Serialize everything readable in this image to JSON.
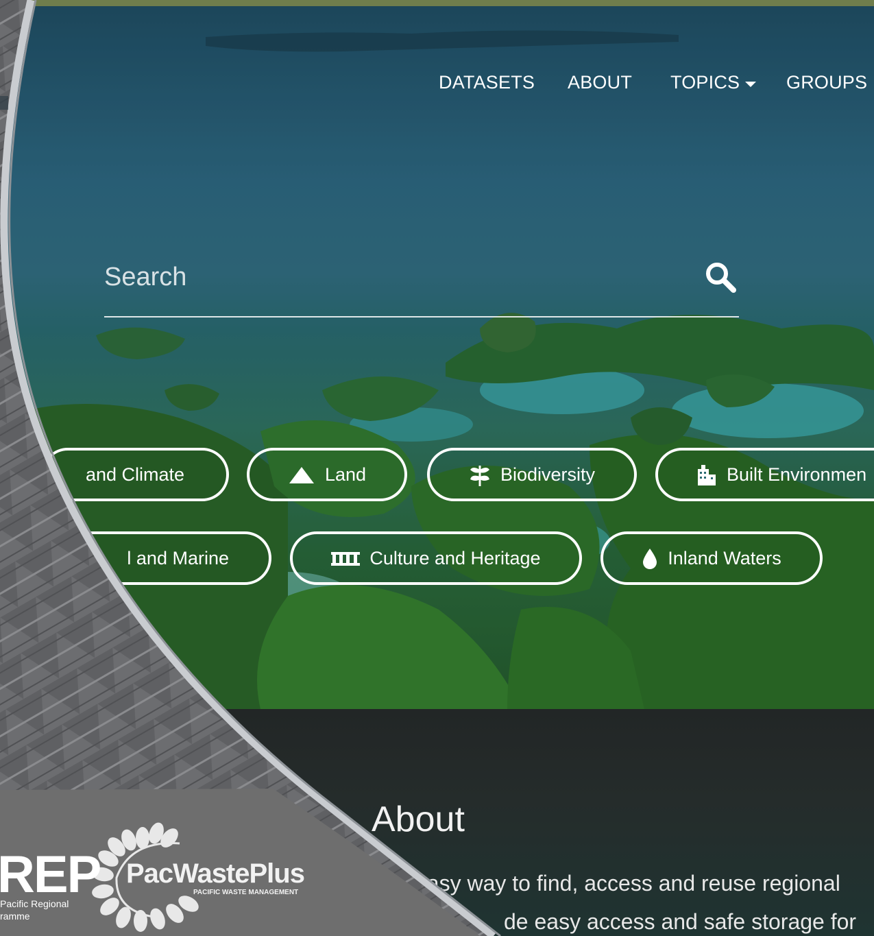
{
  "nav": {
    "items": [
      {
        "label": "DATASETS"
      },
      {
        "label": "ABOUT"
      },
      {
        "label": "TOPICS"
      },
      {
        "label": "GROUPS"
      }
    ]
  },
  "search": {
    "placeholder": "Search",
    "icon": "search-icon"
  },
  "topics": [
    {
      "label": "and Climate",
      "icon": ""
    },
    {
      "label": "Land",
      "icon": "mountain-icon"
    },
    {
      "label": "Biodiversity",
      "icon": "leaf-icon"
    },
    {
      "label": "Built Environmen",
      "icon": "building-icon"
    },
    {
      "label": "l and Marine",
      "icon": ""
    },
    {
      "label": "Culture and Heritage",
      "icon": "monument-icon"
    },
    {
      "label": "Inland Waters",
      "icon": "water-drop-icon"
    }
  ],
  "about": {
    "title": "About",
    "line1": "easy way to find, access and reuse regional",
    "line2": "de easy access and safe storage for"
  },
  "partners": {
    "srep_logo": "REP",
    "srep_sub1": "Pacific Regional",
    "srep_sub2": "ramme",
    "pacwaste_logo": "PacWastePlus",
    "pacwaste_sub": "PACIFIC WASTE MANAGEMENT"
  },
  "colors": {
    "accent_bar": "#6f7d4c",
    "overlay_panel": "#6e6e6e",
    "frame_border": "#9aa0a6"
  }
}
